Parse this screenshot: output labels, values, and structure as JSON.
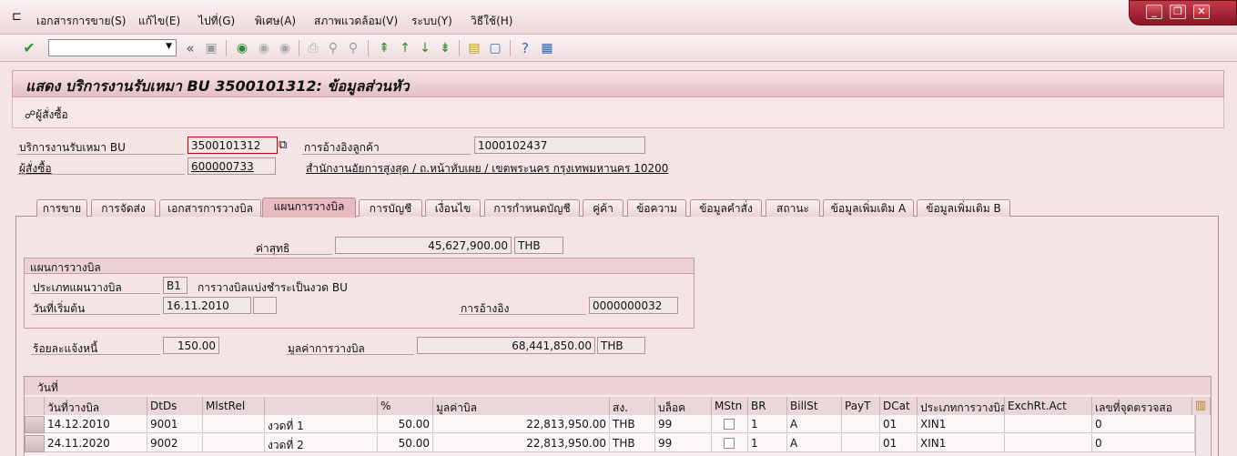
{
  "menu": {
    "items": [
      "เอกสารการขาย(S)",
      "แก้ไข(E)",
      "ไปที่(G)",
      "พิเศษ(A)",
      "สภาพแวดล้อม(V)",
      "ระบบ(Y)",
      "วิธีใช้(H)"
    ]
  },
  "window_controls": {
    "min": "_",
    "restore": "❐",
    "close": "✕"
  },
  "toolbar": {
    "back": "«"
  },
  "title": "แสดง บริการงานรับเหมา BU 3500101312: ข้อมูลส่วนหัว",
  "app_toolbar": {
    "orderer_button": "ผู้สั่งซื้อ"
  },
  "header": {
    "bu_label": "บริการงานรับเหมา BU",
    "bu_value": "3500101312",
    "customer_ref_label": "การอ้างอิงลูกค้า",
    "customer_ref_value": "1000102437",
    "orderer_label": "ผู้สั่งซื้อ",
    "orderer_value": "600000733",
    "orderer_address": "สำนักงานอัยการสูงสุด / ถ.หน้าหับเผย / เขตพระนคร กรุงเทพมหานคร 10200"
  },
  "tabs": [
    "การขาย",
    "การจัดส่ง",
    "เอกสารการวางบิล",
    "แผนการวางบิล",
    "การบัญชี",
    "เงื่อนไข",
    "การกำหนดบัญชี",
    "คู่ค้า",
    "ข้อความ",
    "ข้อมูลคำสั่ง",
    "สถานะ",
    "ข้อมูลเพิ่มเติม A",
    "ข้อมูลเพิ่มเติม B"
  ],
  "active_tab": "แผนการวางบิล",
  "net_value": {
    "label": "ค่าสุทธิ",
    "value": "45,627,900.00",
    "currency": "THB"
  },
  "billing_plan": {
    "group_title": "แผนการวางบิล",
    "type_label": "ประเภทแผนวางบิล",
    "type_value": "B1",
    "type_desc": "การวางบิลแบ่งชำระเป็นงวด BU",
    "start_label": "วันที่เริ่มต้น",
    "start_value": "16.11.2010",
    "start_extra": "",
    "ref_label": "การอ้างอิง",
    "ref_value": "0000000032"
  },
  "notify_pct": {
    "label": "ร้อยละแจ้งหนี้",
    "value": "150.00"
  },
  "billing_value": {
    "label": "มูลค่าการวางบิล",
    "value": "68,441,850.00",
    "currency": "THB"
  },
  "table": {
    "section_title": "วันที่",
    "columns": [
      "วันที่วางบิล",
      "DtDs",
      "MlstRel",
      "",
      "%",
      "มูลค่าบิล",
      "สง.",
      "บล็อค",
      "MStn",
      "BR",
      "BillSt",
      "PayT",
      "DCat",
      "ประเภทการวางบิล",
      "ExchRt.Act",
      "เลขที่จุดตรวจสอ"
    ],
    "rows": [
      [
        "14.12.2010",
        "9001",
        "",
        "งวดที่ 1",
        "50.00",
        "22,813,950.00",
        "THB",
        "99",
        "",
        "1",
        "A",
        "",
        "01",
        "XIN1",
        "",
        "0"
      ],
      [
        "24.11.2020",
        "9002",
        "",
        "งวดที่ 2",
        "50.00",
        "22,813,950.00",
        "THB",
        "99",
        "",
        "1",
        "A",
        "",
        "01",
        "XIN1",
        "",
        "0"
      ]
    ]
  },
  "colors": {
    "accent": "#a31b2b",
    "tab_active": "#e7b9c0",
    "background": "#f4e4e6"
  }
}
